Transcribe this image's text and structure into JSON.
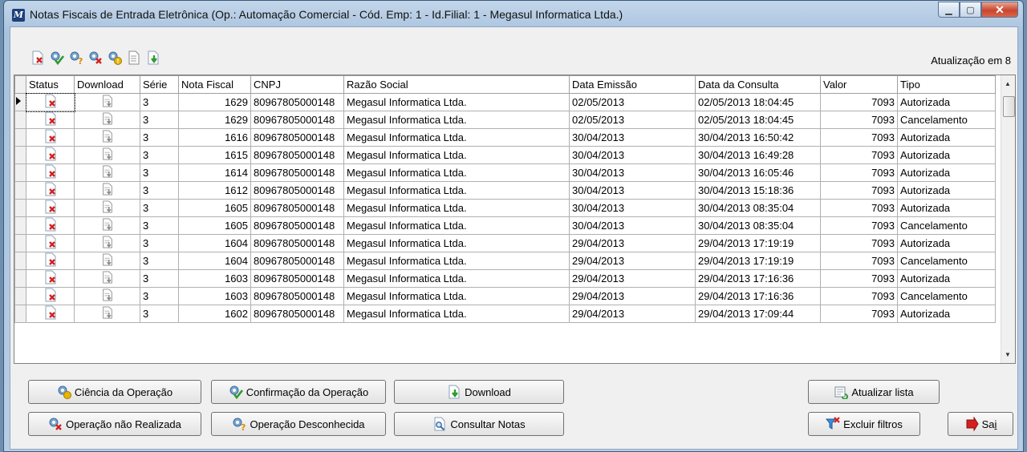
{
  "window": {
    "title": "Notas Fiscais de Entrada Eletrônica (Op.: Automação Comercial - Cód. Emp: 1 - Id.Filial: 1 - Megasul Informatica Ltda.)",
    "min_glyph": "▁",
    "max_glyph": "▢",
    "close_glyph": "✕"
  },
  "toolbar": {
    "icons": [
      "reject-icon",
      "confirm-icon",
      "unknown-icon",
      "not-done-icon",
      "aware-icon",
      "document-icon",
      "download-icon"
    ],
    "update_label": "Atualização em 8"
  },
  "grid": {
    "columns": [
      "Status",
      "Download",
      "Série",
      "Nota Fiscal",
      "CNPJ",
      "Razão Social",
      "Data Emissão",
      "Data da Consulta",
      "Valor",
      "Tipo"
    ],
    "rows": [
      {
        "serie": "3",
        "nota": "1629",
        "cnpj": "80967805000148",
        "razao": "Megasul Informatica Ltda.",
        "emissao": "02/05/2013",
        "consulta": "02/05/2013 18:04:45",
        "valor": "7093",
        "tipo": "Autorizada"
      },
      {
        "serie": "3",
        "nota": "1629",
        "cnpj": "80967805000148",
        "razao": "Megasul Informatica Ltda.",
        "emissao": "02/05/2013",
        "consulta": "02/05/2013 18:04:45",
        "valor": "7093",
        "tipo": "Cancelamento"
      },
      {
        "serie": "3",
        "nota": "1616",
        "cnpj": "80967805000148",
        "razao": "Megasul Informatica Ltda.",
        "emissao": "30/04/2013",
        "consulta": "30/04/2013 16:50:42",
        "valor": "7093",
        "tipo": "Autorizada"
      },
      {
        "serie": "3",
        "nota": "1615",
        "cnpj": "80967805000148",
        "razao": "Megasul Informatica Ltda.",
        "emissao": "30/04/2013",
        "consulta": "30/04/2013 16:49:28",
        "valor": "7093",
        "tipo": "Autorizada"
      },
      {
        "serie": "3",
        "nota": "1614",
        "cnpj": "80967805000148",
        "razao": "Megasul Informatica Ltda.",
        "emissao": "30/04/2013",
        "consulta": "30/04/2013 16:05:46",
        "valor": "7093",
        "tipo": "Autorizada"
      },
      {
        "serie": "3",
        "nota": "1612",
        "cnpj": "80967805000148",
        "razao": "Megasul Informatica Ltda.",
        "emissao": "30/04/2013",
        "consulta": "30/04/2013 15:18:36",
        "valor": "7093",
        "tipo": "Autorizada"
      },
      {
        "serie": "3",
        "nota": "1605",
        "cnpj": "80967805000148",
        "razao": "Megasul Informatica Ltda.",
        "emissao": "30/04/2013",
        "consulta": "30/04/2013 08:35:04",
        "valor": "7093",
        "tipo": "Autorizada"
      },
      {
        "serie": "3",
        "nota": "1605",
        "cnpj": "80967805000148",
        "razao": "Megasul Informatica Ltda.",
        "emissao": "30/04/2013",
        "consulta": "30/04/2013 08:35:04",
        "valor": "7093",
        "tipo": "Cancelamento"
      },
      {
        "serie": "3",
        "nota": "1604",
        "cnpj": "80967805000148",
        "razao": "Megasul Informatica Ltda.",
        "emissao": "29/04/2013",
        "consulta": "29/04/2013 17:19:19",
        "valor": "7093",
        "tipo": "Autorizada"
      },
      {
        "serie": "3",
        "nota": "1604",
        "cnpj": "80967805000148",
        "razao": "Megasul Informatica Ltda.",
        "emissao": "29/04/2013",
        "consulta": "29/04/2013 17:19:19",
        "valor": "7093",
        "tipo": "Cancelamento"
      },
      {
        "serie": "3",
        "nota": "1603",
        "cnpj": "80967805000148",
        "razao": "Megasul Informatica Ltda.",
        "emissao": "29/04/2013",
        "consulta": "29/04/2013 17:16:36",
        "valor": "7093",
        "tipo": "Autorizada"
      },
      {
        "serie": "3",
        "nota": "1603",
        "cnpj": "80967805000148",
        "razao": "Megasul Informatica Ltda.",
        "emissao": "29/04/2013",
        "consulta": "29/04/2013 17:16:36",
        "valor": "7093",
        "tipo": "Cancelamento"
      },
      {
        "serie": "3",
        "nota": "1602",
        "cnpj": "80967805000148",
        "razao": "Megasul Informatica Ltda.",
        "emissao": "29/04/2013",
        "consulta": "29/04/2013 17:09:44",
        "valor": "7093",
        "tipo": "Autorizada"
      }
    ]
  },
  "buttons": {
    "ciencia": "Ciência da Operação",
    "confirmacao": "Confirmação da Operação",
    "download": "Download",
    "atualizar": "Atualizar lista",
    "nao_realizada": "Operação não Realizada",
    "desconhecida": "Operação Desconhecida",
    "consultar": "Consultar Notas",
    "excluir_filtros": "Excluir filtros",
    "sair_prefix": "Sa",
    "sair_underlined": "i",
    "sair_suffix": ""
  },
  "colors": {
    "accent_green": "#2f9a2f",
    "reject_red": "#d42020",
    "warning_yellow": "#e8b400"
  }
}
